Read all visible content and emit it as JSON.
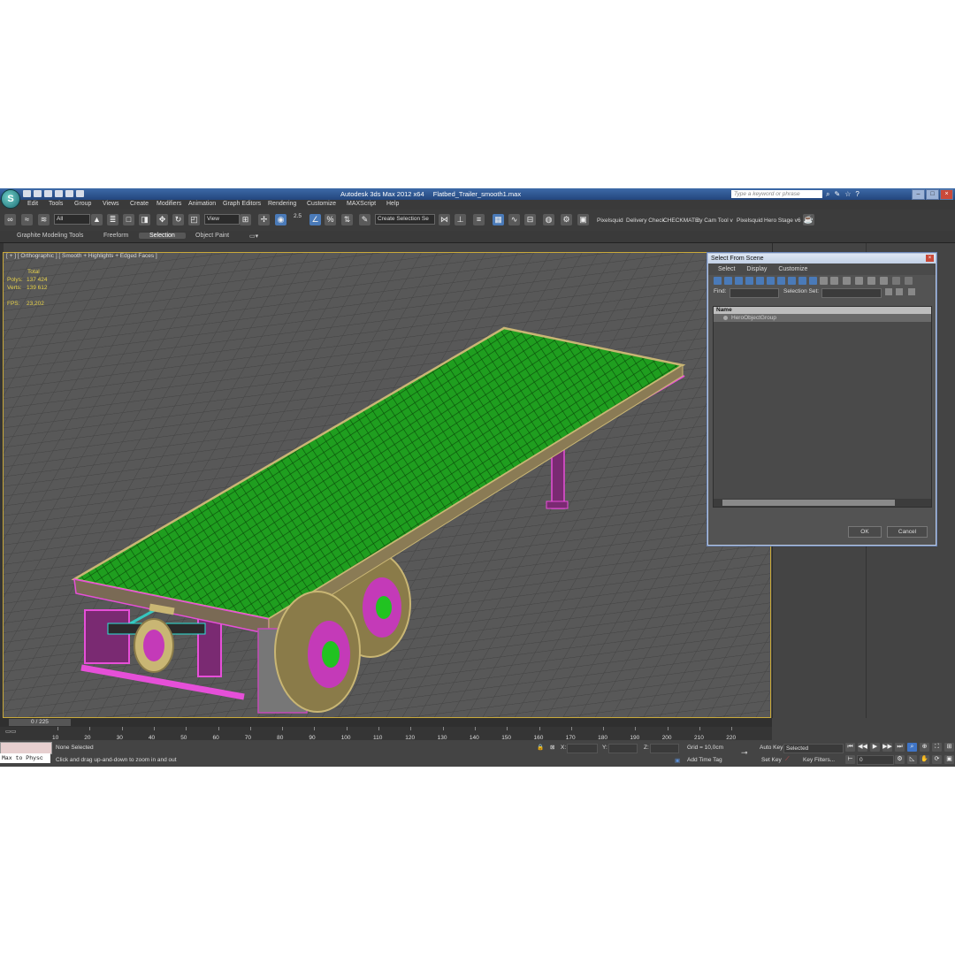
{
  "titlebar": {
    "app_title": "Autodesk 3ds Max  2012 x64",
    "file_name": "Flatbed_Trailer_smooth1.max",
    "search_placeholder": "Type a keyword or phrase"
  },
  "menu": [
    "Edit",
    "Tools",
    "Group",
    "Views",
    "Create",
    "Modifiers",
    "Animation",
    "Graph Editors",
    "Rendering",
    "Customize",
    "MAXScript",
    "Help"
  ],
  "toolbar": {
    "filter_value": "All",
    "ref_coord_value": "View",
    "snap_value": "2.5",
    "named_selection_placeholder": "Create Selection Se",
    "plugin_labels": [
      "Pixelsquid",
      "Delivery Check",
      "CHECKMATE",
      "ity Cam Tool v",
      "Pixelsquid",
      "Hero Stage v6"
    ]
  },
  "ribbon": {
    "tabs": [
      "Graphite Modeling Tools",
      "Freeform",
      "Selection",
      "Object Paint"
    ],
    "active_tab": "Selection"
  },
  "viewport": {
    "label": "[ + ] [ Orthographic ] [ Smooth + Highlights + Edged Faces ]",
    "stats": {
      "header": "Total",
      "polys_label": "Polys:",
      "polys_value": "137 424",
      "verts_label": "Verts:",
      "verts_value": "139 612",
      "fps_label": "FPS:",
      "fps_value": "23,202"
    }
  },
  "dialog": {
    "title": "Select From Scene",
    "menu": [
      "Select",
      "Display",
      "Customize"
    ],
    "find_label": "Find:",
    "selection_set_label": "Selection Set:",
    "column_header": "Name",
    "items": [
      "HeroObjectGroup"
    ],
    "ok_label": "OK",
    "cancel_label": "Cancel"
  },
  "timeline": {
    "frame_display": "0 / 225",
    "ticks": [
      "10",
      "20",
      "30",
      "40",
      "50",
      "60",
      "70",
      "80",
      "90",
      "100",
      "110",
      "120",
      "130",
      "140",
      "150",
      "160",
      "170",
      "180",
      "190",
      "200",
      "210",
      "220"
    ]
  },
  "statusbar": {
    "listener_text": "Max to Physc",
    "selection_status": "None Selected",
    "prompt": "Click and drag up-and-down to zoom in and out",
    "x_label": "X:",
    "y_label": "Y:",
    "z_label": "Z:",
    "grid": "Grid = 10,0cm",
    "add_time_tag": "Add Time Tag",
    "auto_key": "Auto Key",
    "auto_key_value": "Selected",
    "set_key": "Set Key",
    "key_filters": "Key Filters...",
    "current_frame": "0"
  },
  "colors": {
    "deck": "#1f9e1f",
    "frame_lines": "#e64fd8",
    "crossmembers": "#2ee2d8",
    "tires": "#c9b674",
    "rims": "#c43ab8",
    "hubs": "#21c321",
    "viewport_border": "#c9a93a",
    "stats_text": "#e8d24a"
  }
}
